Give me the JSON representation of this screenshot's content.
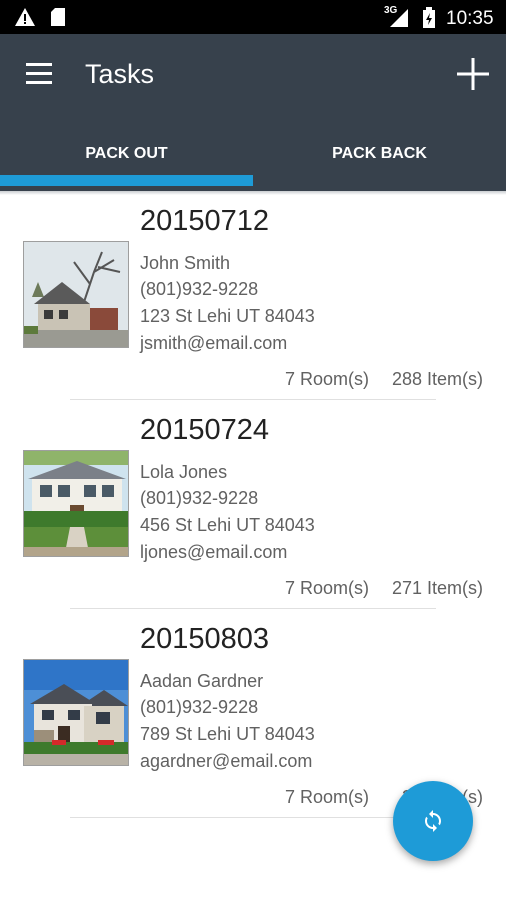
{
  "status_bar": {
    "network_type": "3G",
    "time": "10:35",
    "icons": [
      "warning-icon",
      "sd-card-icon",
      "signal-icon",
      "battery-icon"
    ]
  },
  "app_bar": {
    "title": "Tasks",
    "menu_icon": "hamburger-menu-icon",
    "action_icon": "add-icon",
    "background_color": "#37414c"
  },
  "tabs": [
    {
      "label": "PACK OUT",
      "selected": true
    },
    {
      "label": "PACK BACK",
      "selected": false
    }
  ],
  "accent_color": "#1e9bd7",
  "tasks": [
    {
      "id": "20150712",
      "name": "John Smith",
      "phone": "(801)932-9228",
      "address": "123 St Lehi UT  84043",
      "email": "jsmith@email.com",
      "rooms": "7 Room(s)",
      "items": "288 Item(s)"
    },
    {
      "id": "20150724",
      "name": "Lola Jones",
      "phone": "(801)932-9228",
      "address": "456 St Lehi UT  84043",
      "email": "ljones@email.com",
      "rooms": "7 Room(s)",
      "items": "271 Item(s)"
    },
    {
      "id": "20150803",
      "name": "Aadan Gardner",
      "phone": "(801)932-9228",
      "address": "789 St Lehi UT  84043",
      "email": "agardner@email.com",
      "rooms": "7 Room(s)",
      "items": "30 Item(s)"
    }
  ],
  "fab": {
    "icon": "sync-icon"
  }
}
